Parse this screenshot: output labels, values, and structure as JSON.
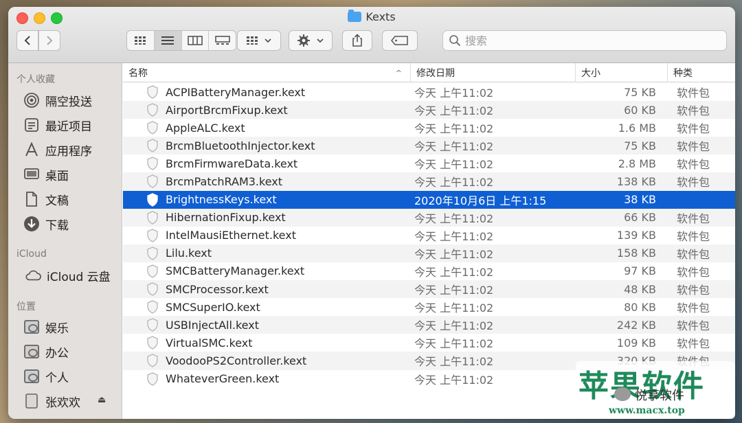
{
  "window": {
    "title": "Kexts"
  },
  "toolbar": {
    "back_icon": "chevron-left-icon",
    "forward_icon": "chevron-right-icon",
    "search_placeholder": "搜索"
  },
  "sidebar": {
    "favorites_header": "个人收藏",
    "favorites": [
      {
        "label": "隔空投送",
        "icon": "airdrop-icon"
      },
      {
        "label": "最近项目",
        "icon": "recents-icon"
      },
      {
        "label": "应用程序",
        "icon": "applications-icon"
      },
      {
        "label": "桌面",
        "icon": "desktop-icon"
      },
      {
        "label": "文稿",
        "icon": "documents-icon"
      },
      {
        "label": "下载",
        "icon": "downloads-icon"
      }
    ],
    "icloud_header": "iCloud",
    "icloud": [
      {
        "label": "iCloud 云盘",
        "icon": "cloud-icon"
      }
    ],
    "locations_header": "位置",
    "locations": [
      {
        "label": "娱乐",
        "icon": "disk-icon"
      },
      {
        "label": "办公",
        "icon": "disk-icon"
      },
      {
        "label": "个人",
        "icon": "disk-icon"
      },
      {
        "label": "张欢欢",
        "icon": "drive-icon"
      }
    ]
  },
  "columns": {
    "name": "名称",
    "date": "修改日期",
    "size": "大小",
    "kind": "种类"
  },
  "files": [
    {
      "name": "ACPIBatteryManager.kext",
      "date": "今天 上午11:02",
      "size": "75 KB",
      "kind": "软件包"
    },
    {
      "name": "AirportBrcmFixup.kext",
      "date": "今天 上午11:02",
      "size": "60 KB",
      "kind": "软件包"
    },
    {
      "name": "AppleALC.kext",
      "date": "今天 上午11:02",
      "size": "1.6 MB",
      "kind": "软件包"
    },
    {
      "name": "BrcmBluetoothInjector.kext",
      "date": "今天 上午11:02",
      "size": "75 KB",
      "kind": "软件包"
    },
    {
      "name": "BrcmFirmwareData.kext",
      "date": "今天 上午11:02",
      "size": "2.8 MB",
      "kind": "软件包"
    },
    {
      "name": "BrcmPatchRAM3.kext",
      "date": "今天 上午11:02",
      "size": "138 KB",
      "kind": "软件包"
    },
    {
      "name": "BrightnessKeys.kext",
      "date": "2020年10月6日 上午1:15",
      "size": "38 KB",
      "kind": "",
      "selected": true
    },
    {
      "name": "HibernationFixup.kext",
      "date": "今天 上午11:02",
      "size": "66 KB",
      "kind": "软件包"
    },
    {
      "name": "IntelMausiEthernet.kext",
      "date": "今天 上午11:02",
      "size": "139 KB",
      "kind": "软件包"
    },
    {
      "name": "Lilu.kext",
      "date": "今天 上午11:02",
      "size": "158 KB",
      "kind": "软件包"
    },
    {
      "name": "SMCBatteryManager.kext",
      "date": "今天 上午11:02",
      "size": "97 KB",
      "kind": "软件包"
    },
    {
      "name": "SMCProcessor.kext",
      "date": "今天 上午11:02",
      "size": "48 KB",
      "kind": "软件包"
    },
    {
      "name": "SMCSuperIO.kext",
      "date": "今天 上午11:02",
      "size": "80 KB",
      "kind": "软件包"
    },
    {
      "name": "USBInjectAll.kext",
      "date": "今天 上午11:02",
      "size": "242 KB",
      "kind": "软件包"
    },
    {
      "name": "VirtualSMC.kext",
      "date": "今天 上午11:02",
      "size": "109 KB",
      "kind": "软件包"
    },
    {
      "name": "VoodooPS2Controller.kext",
      "date": "今天 上午11:02",
      "size": "320 KB",
      "kind": "软件包"
    },
    {
      "name": "WhateverGreen.kext",
      "date": "今天 上午11:02",
      "size": "",
      "kind": ""
    }
  ],
  "watermark": {
    "title": "苹果软件",
    "subtitle": "悦享软件",
    "url": "www.macx.top"
  },
  "colors": {
    "selection": "#0f5fd3",
    "sidebar_bg": "#e3e0dd",
    "watermark": "#1f8a5a"
  }
}
